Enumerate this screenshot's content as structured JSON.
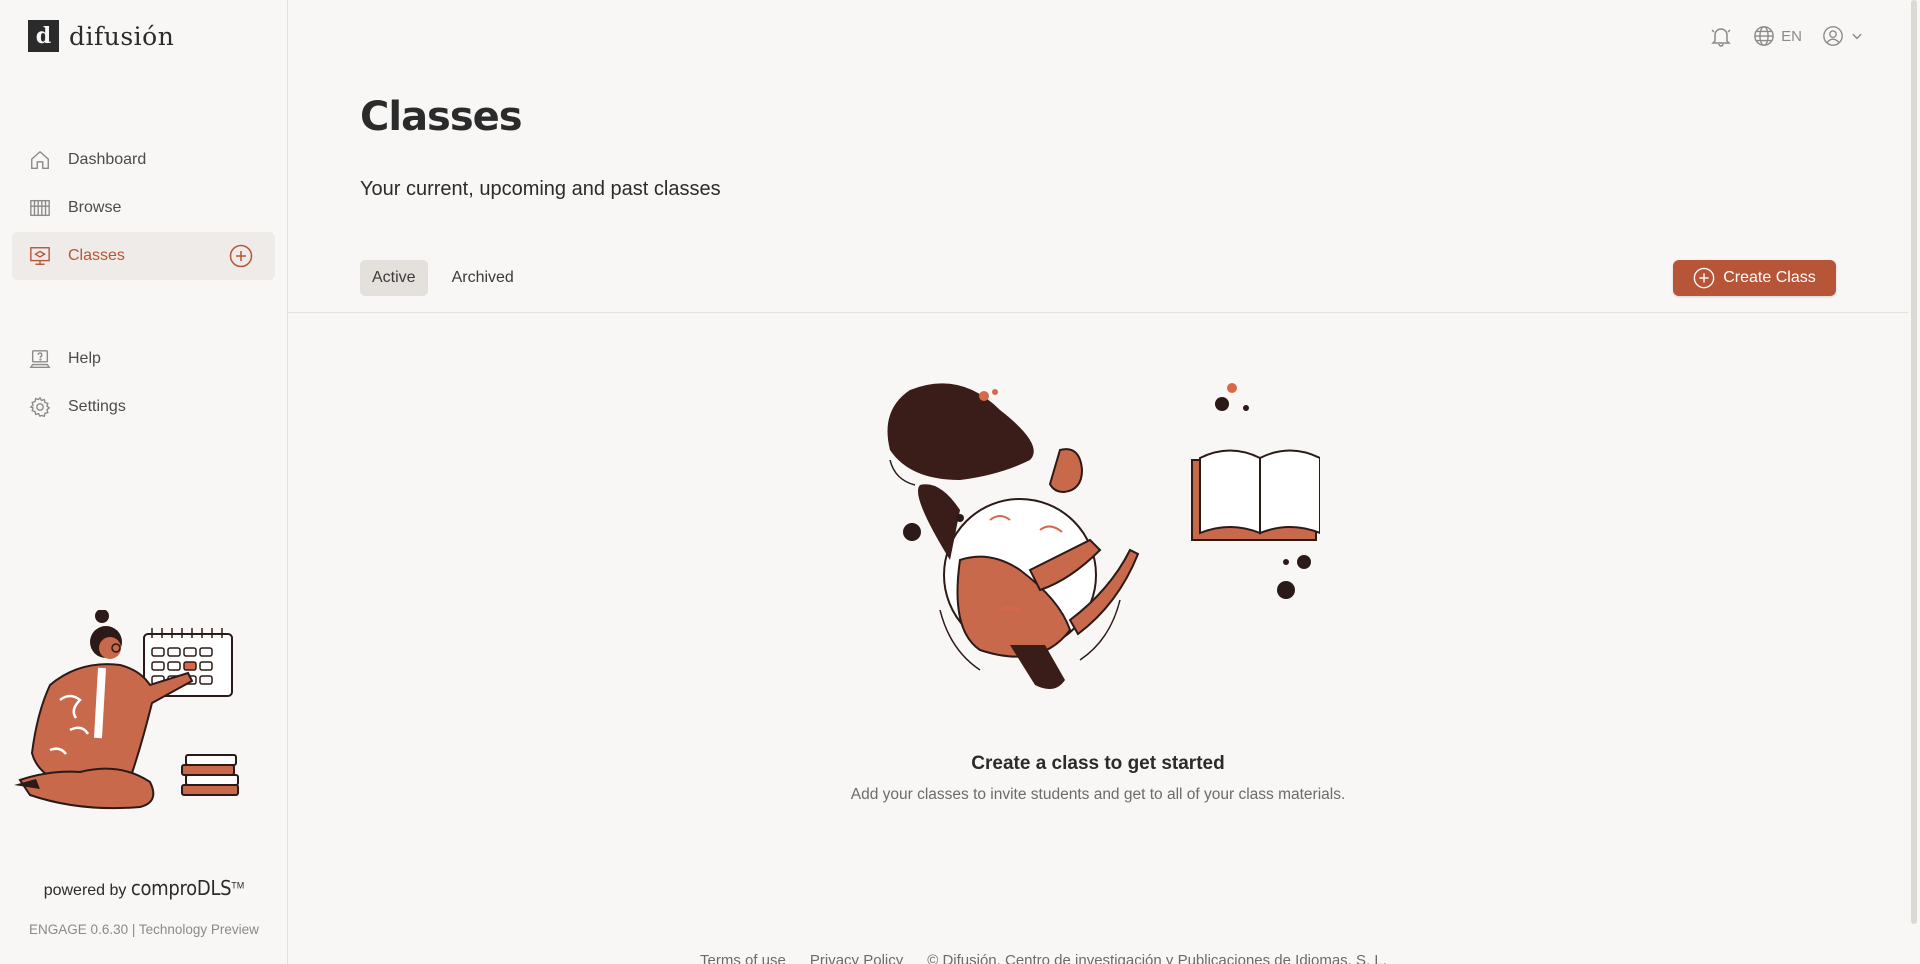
{
  "brand": {
    "logo_mark": "d",
    "name": "difusión"
  },
  "sidebar": {
    "items": [
      {
        "label": "Dashboard",
        "icon": "home-icon"
      },
      {
        "label": "Browse",
        "icon": "browse-icon"
      },
      {
        "label": "Classes",
        "icon": "classes-icon",
        "active": true
      },
      {
        "label": "Help",
        "icon": "help-icon"
      },
      {
        "label": "Settings",
        "icon": "gear-icon"
      }
    ],
    "powered_prefix": "powered by",
    "powered_brand": "comproDLS",
    "powered_tm": "TM",
    "version": "ENGAGE 0.6.30 | Technology Preview"
  },
  "topbar": {
    "language": "EN"
  },
  "main": {
    "title": "Classes",
    "subtitle": "Your current, upcoming and past classes",
    "tabs": [
      {
        "label": "Active",
        "active": true
      },
      {
        "label": "Archived"
      }
    ],
    "create_button": "Create Class",
    "empty_title": "Create a class to get started",
    "empty_text": "Add your classes to invite students and get to all of your class materials."
  },
  "footer": {
    "links": [
      "Terms of use",
      "Privacy Policy",
      "© Difusión, Centro de investigación y Publicaciones de Idiomas, S. L."
    ]
  },
  "colors": {
    "accent": "#b65537",
    "dark": "#2b2b2b",
    "background": "#f9f7f5"
  }
}
